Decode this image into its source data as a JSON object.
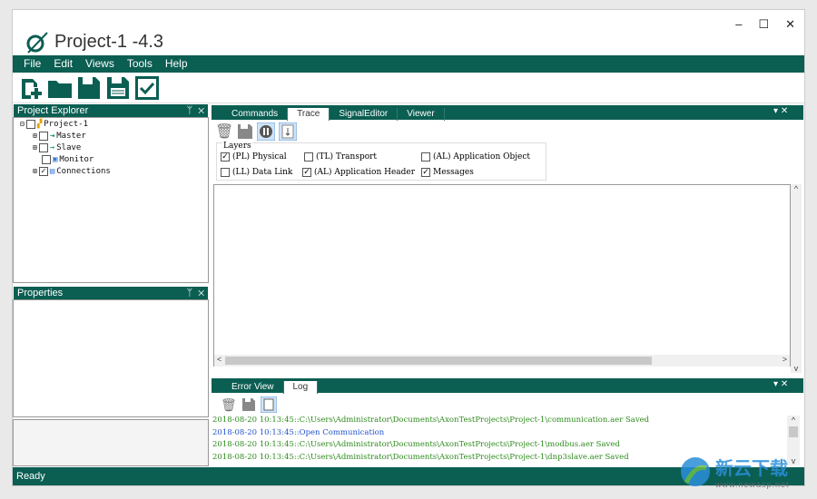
{
  "app": {
    "title": "Project-1 -4.3",
    "minimize": "–",
    "maximize": "☐",
    "close": "✕"
  },
  "menu": [
    "File",
    "Edit",
    "Views",
    "Tools",
    "Help"
  ],
  "toolbar": [
    "new-project",
    "open-folder",
    "save",
    "save-as",
    "validate"
  ],
  "project_explorer": {
    "title": "Project Explorer",
    "pin": "ᛘ",
    "close": "✕",
    "tree": [
      {
        "label": "Project-1",
        "checked": false
      },
      {
        "label": "Master",
        "checked": false
      },
      {
        "label": "Slave",
        "checked": false
      },
      {
        "label": "Monitor",
        "checked": false
      },
      {
        "label": "Connections",
        "checked": true
      }
    ]
  },
  "properties": {
    "title": "Properties",
    "pin": "ᛘ",
    "close": "✕"
  },
  "main_tabs": [
    "Commands",
    "Trace",
    "SignalEditor",
    "Viewer"
  ],
  "active_main_tab": "Trace",
  "layers": {
    "title": "Layers",
    "items": [
      {
        "label": "(PL) Physical",
        "checked": true
      },
      {
        "label": "(TL) Transport",
        "checked": false
      },
      {
        "label": "(AL) Application Object",
        "checked": false
      },
      {
        "label": "(LL) Data Link",
        "checked": false
      },
      {
        "label": "(AL) Application Header",
        "checked": true
      },
      {
        "label": "Messages",
        "checked": true
      }
    ]
  },
  "log_tabs": [
    "Error View",
    "Log"
  ],
  "active_log_tab": "Log",
  "log": [
    {
      "text": "2018-08-20 10:13:45::C:\\Users\\Administrator\\Documents\\AxonTestProjects\\Project-1\\communication.aer Saved",
      "color": "#2e8b1e"
    },
    {
      "text": "2018-08-20 10:13:45::Open Communication",
      "color": "#2255cc"
    },
    {
      "text": "2018-08-20 10:13:45::C:\\Users\\Administrator\\Documents\\AxonTestProjects\\Project-1\\modbus.aer Saved",
      "color": "#2e8b1e"
    },
    {
      "text": "2018-08-20 10:13:45::C:\\Users\\Administrator\\Documents\\AxonTestProjects\\Project-1\\dnp3slave.aer Saved",
      "color": "#2e8b1e"
    }
  ],
  "status": "Ready",
  "watermark": {
    "text": "新云下载",
    "url": "www.newasp.net"
  },
  "colors": {
    "accent": "#0b5e52"
  }
}
